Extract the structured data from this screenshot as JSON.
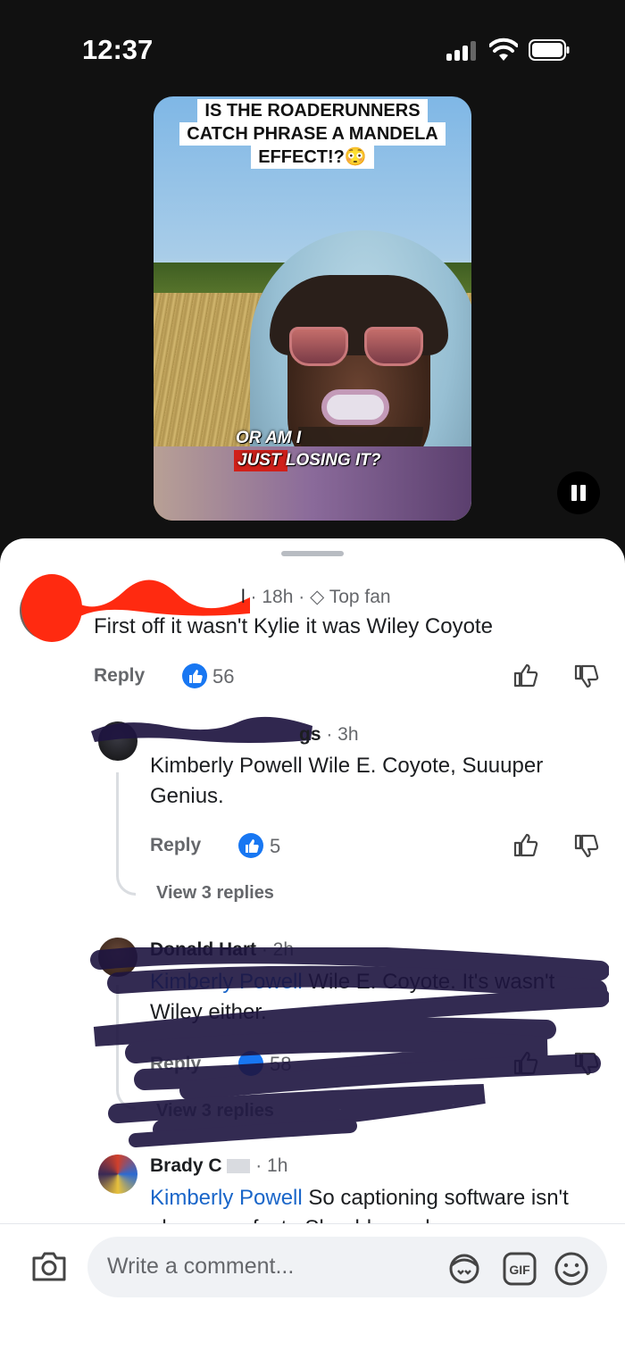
{
  "status": {
    "time": "12:37"
  },
  "video": {
    "title_lines": [
      "IS THE ROADERUNNERS",
      "CATCH PHRASE A MANDELA",
      "EFFECT!?😳"
    ],
    "subtitle_line1": "OR AM I",
    "subtitle_line2": "JUST LOSING IT?"
  },
  "comments": [
    {
      "author_suffix": "l",
      "time": "· 18h ·",
      "badge": "Top fan",
      "text": "First off it wasn't Kylie it was Wiley Coyote",
      "reply_label": "Reply",
      "likes": "56"
    },
    {
      "author_suffix": "gs",
      "time": "· 3h",
      "text": "Kimberly Powell Wile E. Coyote, Suuuper Genius.",
      "reply_label": "Reply",
      "likes": "5",
      "view_replies": "View 3 replies"
    },
    {
      "author": "Donald Hart",
      "time": "· 2h",
      "mention": "Kimberly Powell",
      "text": "Wile E. Coyote. It's wasn't Wiley either.",
      "reply_label": "Reply",
      "likes": "58",
      "view_replies": "View 3 replies"
    },
    {
      "author": "Brady C",
      "time": "· 1h",
      "mention": "Kimberly Powell",
      "text": "So captioning software isn't always perfect . Should people"
    }
  ],
  "composer": {
    "placeholder": "Write a comment..."
  },
  "icons": [
    "signal-icon",
    "wifi-icon",
    "battery-icon",
    "pause-icon",
    "like-icon",
    "thumbs-up-icon",
    "thumbs-down-icon",
    "diamond-icon",
    "camera-icon",
    "avatar-sticker-icon",
    "gif-icon",
    "emoji-icon"
  ],
  "colors": {
    "accent": "#1877f2",
    "mention": "#1a66c9",
    "muted": "#65676b",
    "scribble_red": "#ff2a10",
    "scribble_purple": "#1e1540"
  }
}
